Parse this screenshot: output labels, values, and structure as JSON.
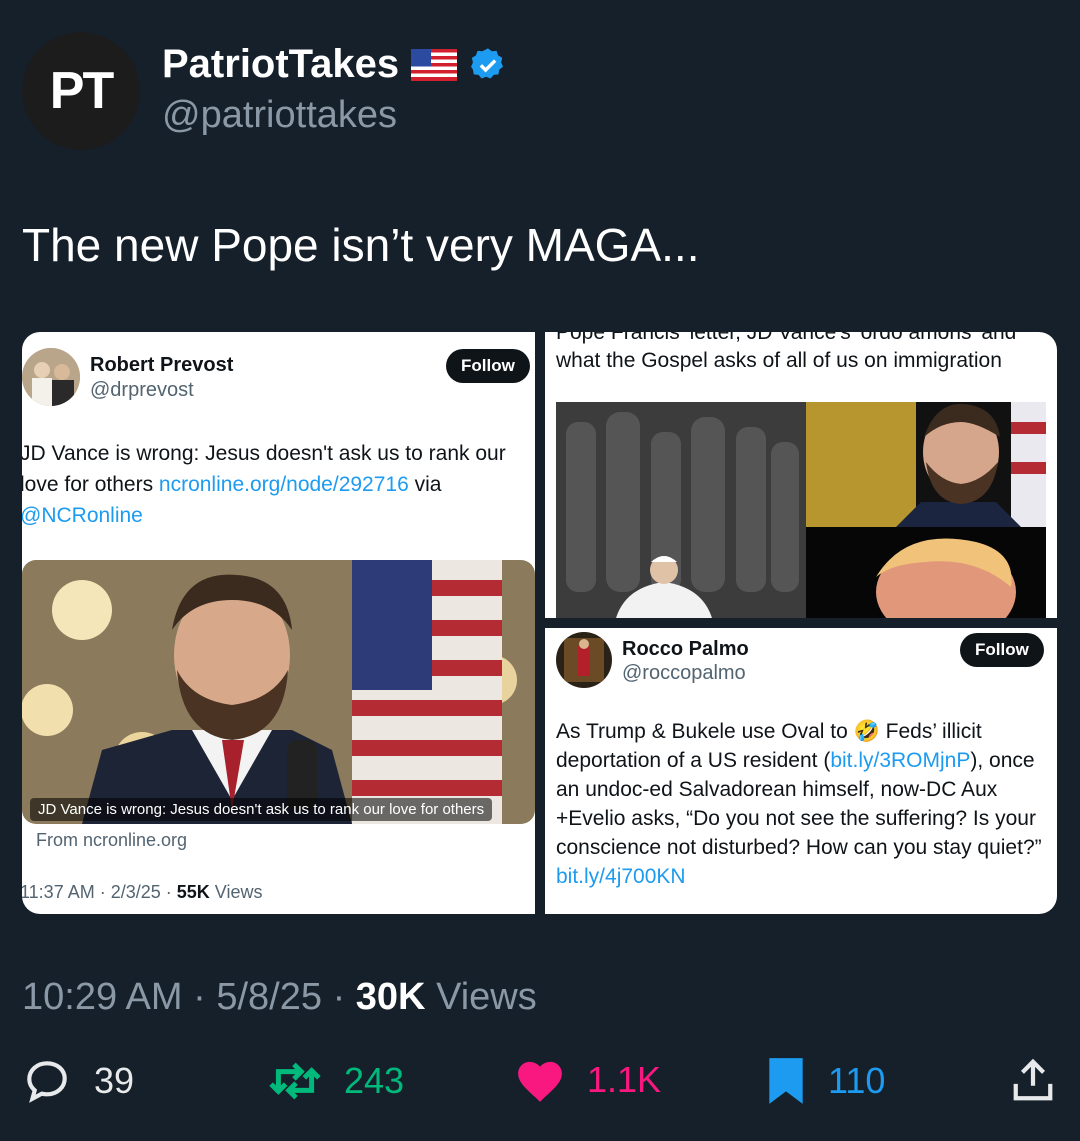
{
  "account": {
    "avatar_text": "PT",
    "name": "PatriotTakes",
    "flag_icon": "us-flag-icon",
    "verified_icon": "verified-badge-icon",
    "handle": "@patriottakes"
  },
  "tweet": {
    "text": "The new Pope isn’t very MAGA...",
    "time": "10:29 AM",
    "date": "5/8/25",
    "views_count": "30K",
    "views_label": "Views"
  },
  "embed_left": {
    "name": "Robert Prevost",
    "handle": "@drprevost",
    "follow_label": "Follow",
    "text_main": "JD Vance is wrong: Jesus doesn't ask us to rank our love for others ",
    "text_link": "ncronline.org/node/292716",
    "text_via": " via ",
    "text_mention": "@NCRonline",
    "image_caption": "JD Vance is wrong: Jesus doesn't ask us to rank our love for others",
    "source": "From ncronline.org",
    "timestamp": "11:37 AM · 2/3/25 · ",
    "views_count": "55K",
    "views_label": " Views"
  },
  "embed_right_top": {
    "clipped_line": "Pope Francis' letter, JD Vance's 'ordo amoris' and",
    "text": "what the Gospel asks of all of us on immigration"
  },
  "embed_right_bottom": {
    "name": "Rocco Palmo",
    "handle": "@roccopalmo",
    "follow_label": "Follow",
    "text_1": "As Trump & Bukele use Oval to ",
    "emoji": "🤣",
    "text_2": " Feds’ illicit deportation of a US resident (",
    "link_1": "bit.ly/3ROMjnP",
    "text_3": "), once an undoc-ed Salvadorean himself, now-DC Aux +Evelio asks, “Do you not see the suffering? Is your conscience not disturbed? How can you stay quiet?” ",
    "link_2": "bit.ly/4j700KN"
  },
  "actions": {
    "replies": "39",
    "retweets": "243",
    "likes": "1.1K",
    "bookmarks": "110"
  },
  "colors": {
    "background": "#15202b",
    "retweet": "#00ba7c",
    "like": "#f91880",
    "bookmark": "#1d9bf0",
    "link": "#1d9bf0"
  }
}
